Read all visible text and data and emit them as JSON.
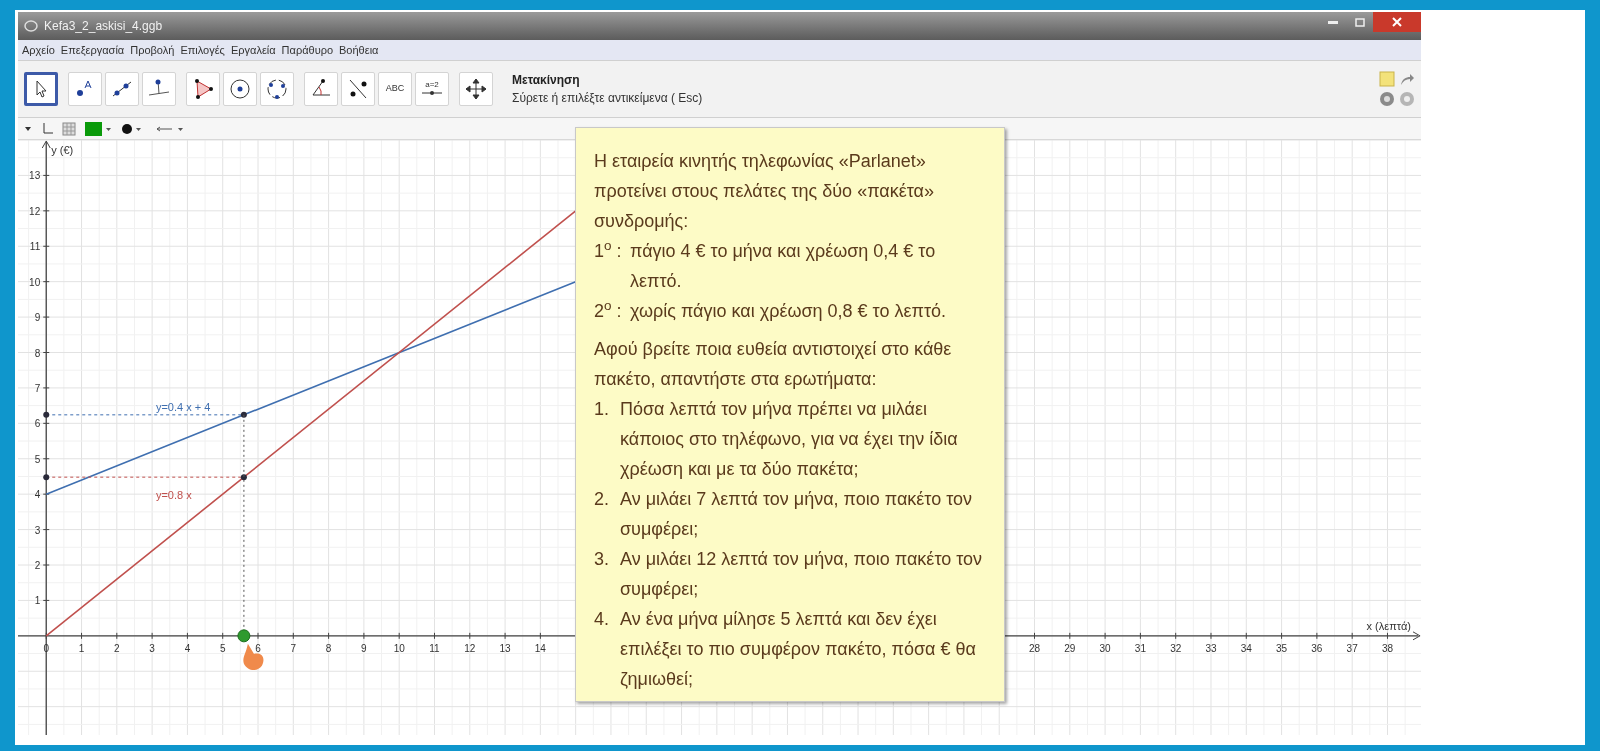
{
  "window": {
    "title": "Kefa3_2_askisi_4.ggb"
  },
  "menu": [
    "Αρχείο",
    "Επεξεργασία",
    "Προβολή",
    "Επιλογές",
    "Εργαλεία",
    "Παράθυρο",
    "Βοήθεια"
  ],
  "toolbar": {
    "tools": [
      {
        "kind": "move",
        "selected": true
      },
      {
        "kind": "point",
        "selected": false
      },
      {
        "kind": "line",
        "selected": false
      },
      {
        "kind": "perpendicular",
        "selected": false
      },
      {
        "kind": "polygon",
        "selected": false
      },
      {
        "kind": "circle",
        "selected": false
      },
      {
        "kind": "circle3",
        "selected": false
      },
      {
        "kind": "angle",
        "selected": false
      },
      {
        "kind": "reflect",
        "selected": false
      },
      {
        "kind": "text",
        "label": "ABC",
        "selected": false
      },
      {
        "kind": "slider",
        "label": "a=2",
        "selected": false
      },
      {
        "kind": "pan",
        "selected": false
      }
    ],
    "tool_name": "Μετακίνηση",
    "tool_help": "Σύρετε ή επιλέξτε αντικείμενα ( Esc)"
  },
  "graphics": {
    "chart_data": {
      "type": "line",
      "xlabel": "x (λεπτά)",
      "ylabel": "y (€)",
      "x": [
        0,
        5.6,
        15
      ],
      "series": [
        {
          "name": "y=0.4 x + 4",
          "color": "#3f6fb0",
          "values": [
            4,
            6.24,
            10
          ]
        },
        {
          "name": "y=0.8 x",
          "color": "#c0504d",
          "values": [
            0,
            4.48,
            12
          ]
        }
      ],
      "xlim": [
        -0.8,
        38.95
      ],
      "ylim": [
        -2.8,
        14
      ],
      "xticks": [
        0,
        1,
        2,
        3,
        4,
        5,
        6,
        7,
        8,
        9,
        10,
        11,
        12,
        13,
        14,
        28,
        29,
        30,
        31,
        32,
        33,
        34,
        35,
        36,
        37,
        38
      ],
      "yticks": [
        1,
        2,
        3,
        4,
        5,
        6,
        7,
        8,
        9,
        10,
        11,
        12,
        13
      ],
      "grid": true
    }
  },
  "note": {
    "intro": "Η εταιρεία κινητής τηλεφωνίας «Parlanet» προτείνει στους πελάτες της δύο «πακέτα» συνδρομής:",
    "packages": [
      {
        "marker": "1$^{ο}$ :",
        "text": "πάγιο 4 € το μήνα και χρέωση 0,4 € το λεπτό."
      },
      {
        "marker": "2$^{ο}$ :",
        "text": "χωρίς πάγιο και χρέωση 0,8 € το λεπτό."
      }
    ],
    "instruction": "Αφού βρείτε ποια ευθεία αντιστοιχεί στο κάθε πακέτο, απαντήστε στα ερωτήματα:",
    "questions": [
      {
        "number": "1.",
        "text": "Πόσα λεπτά τον μήνα πρέπει να μιλάει κάποιος στο τηλέφωνο, για να έχει την ίδια χρέωση και με τα δύο πακέτα;"
      },
      {
        "number": "2.",
        "text": "Αν μιλάει 7 λεπτά τον μήνα, ποιο πακέτο τον συμφέρει;"
      },
      {
        "number": "3.",
        "text": "Αν μιλάει 12 λεπτά τον μήνα, ποιο πακέτο τον συμφέρει;"
      },
      {
        "number": "4.",
        "text": "Αν ένα μήνα μίλησε 5 λεπτά και δεν έχει επιλέξει το πιο συμφέρον πακέτο, πόσα € θα ζημιωθεί;"
      }
    ]
  }
}
